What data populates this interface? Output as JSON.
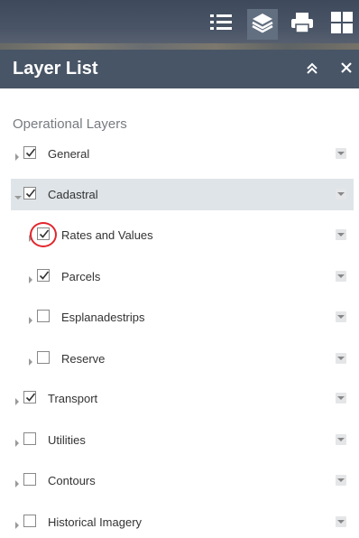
{
  "toolbar": {
    "icons": [
      "list-icon",
      "layers-icon",
      "print-icon",
      "grid-icon"
    ]
  },
  "panel": {
    "title": "Layer List",
    "collapse_icon": "double-chevron-up-icon",
    "close_icon": "close-icon"
  },
  "section_title": "Operational Layers",
  "layers": [
    {
      "label": "General",
      "checked": true,
      "expanded": false,
      "level": 0
    },
    {
      "label": "Cadastral",
      "checked": true,
      "expanded": true,
      "level": 0,
      "selected": true
    },
    {
      "label": "Rates and Values",
      "checked": true,
      "expanded": false,
      "level": 1,
      "highlighted": true
    },
    {
      "label": "Parcels",
      "checked": true,
      "expanded": false,
      "level": 1
    },
    {
      "label": "Esplanadestrips",
      "checked": false,
      "expanded": false,
      "level": 1
    },
    {
      "label": "Reserve",
      "checked": false,
      "expanded": false,
      "level": 1
    },
    {
      "label": "Transport",
      "checked": true,
      "expanded": false,
      "level": 0
    },
    {
      "label": "Utilities",
      "checked": false,
      "expanded": false,
      "level": 0
    },
    {
      "label": "Contours",
      "checked": false,
      "expanded": false,
      "level": 0
    },
    {
      "label": "Historical Imagery",
      "checked": false,
      "expanded": false,
      "level": 0
    }
  ],
  "colors": {
    "header": "#485566",
    "selected_row": "#dfe4e8",
    "highlight_circle": "#e2262d"
  }
}
